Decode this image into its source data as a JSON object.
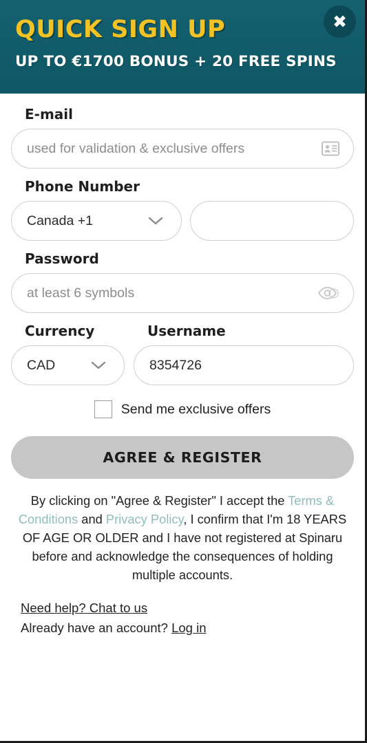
{
  "header": {
    "title": "QUICK SIGN UP",
    "subtitle": "UP TO €1700 BONUS + 20 FREE SPINS",
    "close_icon": "close-icon",
    "close_glyph": "✖",
    "background_color": "#125f6e",
    "title_color": "#f3c224",
    "subtitle_color": "#ffffff"
  },
  "form": {
    "email": {
      "label": "E-mail",
      "value": "",
      "placeholder": "used for validation & exclusive offers",
      "icon": "contact-card-icon"
    },
    "phone": {
      "label": "Phone Number",
      "country_code_value": "Canada +1",
      "number_value": "",
      "number_placeholder": "",
      "chevron_icon": "chevron-down-icon"
    },
    "password": {
      "label": "Password",
      "value": "",
      "placeholder": "at least 6 symbols",
      "icon": "eye-icon"
    },
    "currency": {
      "label": "Currency",
      "value": "CAD",
      "chevron_icon": "chevron-down-icon"
    },
    "username": {
      "label": "Username",
      "value": "8354726",
      "placeholder": ""
    },
    "offers_checkbox": {
      "label": "Send me exclusive offers",
      "checked": false
    },
    "submit": {
      "label": "AGREE & REGISTER",
      "background_color": "#c6c6c6"
    }
  },
  "legal": {
    "part1": "By clicking on \"Agree & Register\" I accept the ",
    "terms_link": "Terms & Conditions",
    "part2": " and ",
    "privacy_link": "Privacy Policy",
    "part3": ", I confirm that I'm 18 YEARS OF AGE OR OLDER and I have not registered at Spinaru before and acknowledge the consequences of holding multiple accounts.",
    "link_color": "#8fbdb8"
  },
  "footer": {
    "help_link": "Need help? Chat to us",
    "account_prompt": "Already have an account? ",
    "login_link": "Log in"
  }
}
